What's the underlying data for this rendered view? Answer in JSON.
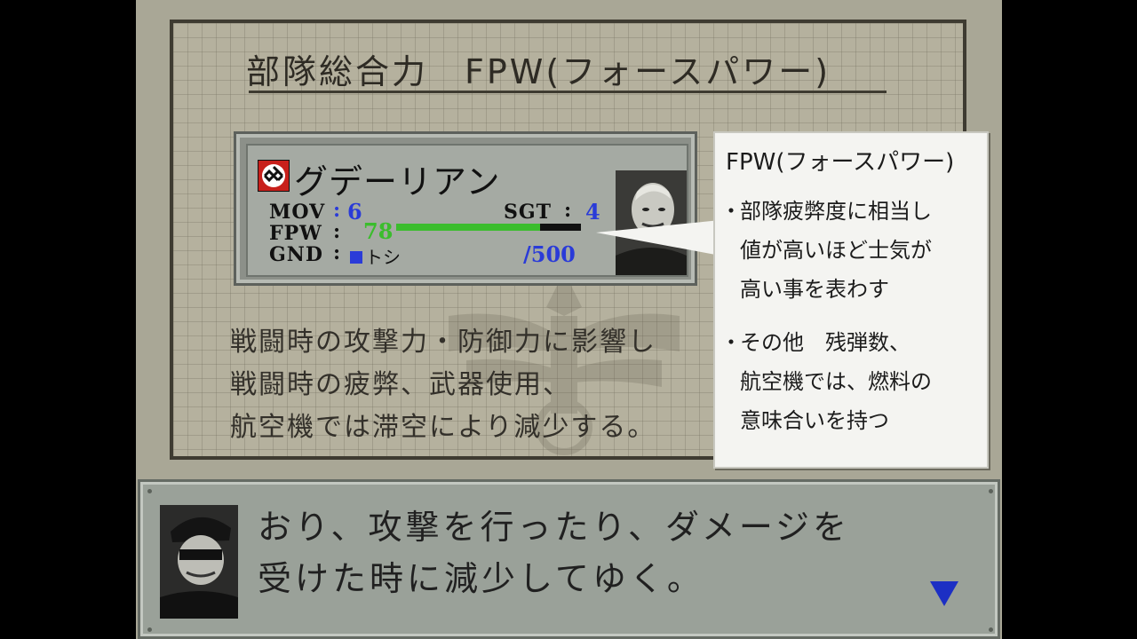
{
  "title": "部隊総合力　FPW(フォースパワー)",
  "unit_card": {
    "name": "グデーリアン",
    "mov_label": "MOV",
    "mov_value": "6",
    "sgt_label": "SGT",
    "sgt_value": "4",
    "fpw_label": "FPW",
    "fpw_value": "78",
    "fpw_max": "/500",
    "fpw_fraction": 0.78,
    "gnd_label": "GND",
    "gnd_value": "トシ",
    "colon": ":",
    "colors": {
      "stat_value": "#2a3bd8",
      "fpw_bar": "#3bbd2d",
      "gnd_square": "#2a3bd8"
    }
  },
  "tooltip": {
    "title": "FPW(フォースパワー)",
    "bullet_mark": "・",
    "bullets": [
      {
        "lines": [
          "部隊疲弊度に相当し",
          "値が高いほど士気が",
          "高い事を表わす"
        ]
      },
      {
        "lines": [
          "その他　残弾数、",
          "航空機では、燃料の",
          "意味合いを持つ"
        ]
      }
    ]
  },
  "description": {
    "lines": [
      "戦闘時の攻撃力・防御力に影響し",
      "戦闘時の疲弊、武器使用、",
      "航空機では滞空により減少する。"
    ]
  },
  "dialog": {
    "lines": [
      "おり、攻撃を行ったり、ダメージを",
      "受けた時に減少してゆく。"
    ],
    "advance_icon": "triangle-down-icon",
    "advance_color": "#1c2fc4"
  }
}
